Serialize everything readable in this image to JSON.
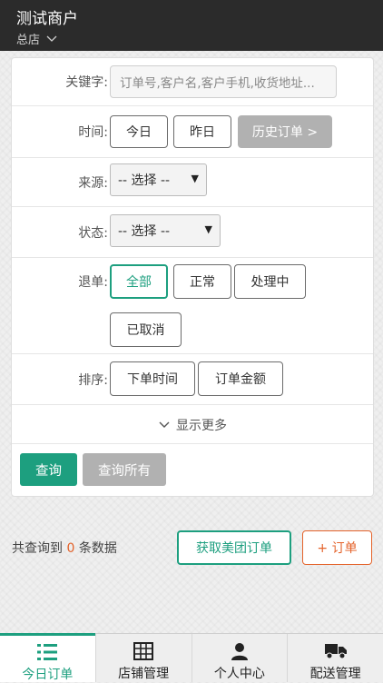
{
  "header": {
    "title": "测试商户",
    "store": "总店"
  },
  "filters": {
    "keyword_label": "关键字:",
    "keyword_placeholder": "订单号,客户名,客户手机,收货地址...",
    "time_label": "时间:",
    "time_today": "今日",
    "time_yesterday": "昨日",
    "time_history": "历史订单 >",
    "source_label": "来源:",
    "source_value": "-- 选择 --",
    "status_label": "状态:",
    "status_value": "-- 选择 --",
    "refund_label": "退单:",
    "refund_all": "全部",
    "refund_normal": "正常",
    "refund_processing": "处理中",
    "refund_cancelled": "已取消",
    "sort_label": "排序:",
    "sort_time": "下单时间",
    "sort_amount": "订单金额",
    "show_more": "显示更多",
    "query": "查询",
    "query_all": "查询所有"
  },
  "results": {
    "prefix": "共查询到",
    "count": "0",
    "suffix": "条数据",
    "meituan_button": "获取美团订单",
    "add_order_button": "+ 订单"
  },
  "tabs": [
    {
      "label": "今日订单",
      "icon": "list-icon"
    },
    {
      "label": "店铺管理",
      "icon": "grid-icon"
    },
    {
      "label": "个人中心",
      "icon": "user-icon"
    },
    {
      "label": "配送管理",
      "icon": "truck-icon"
    }
  ],
  "colors": {
    "accent": "#1d9f7f",
    "orange": "#e4632b",
    "header": "#2b2b2b"
  }
}
